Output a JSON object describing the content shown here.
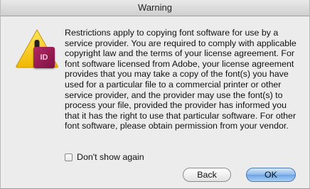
{
  "window": {
    "title": "Warning"
  },
  "icon": {
    "badge_text": "ID"
  },
  "dialog": {
    "message": "Restrictions apply to copying font software for use by a service provider.  You are required to comply with applicable copyright law and the terms of your license agreement.  For font software licensed from Adobe, your license agreement provides that you may take a copy of the font(s) you have used for a particular file to a commercial printer or other service provider, and the provider may use the font(s) to process your file, provided the provider has informed you that it has the right to use that particular software.  For other font software, please obtain permission from your vendor.",
    "checkbox_label": "Don't show again",
    "checkbox_checked": false
  },
  "buttons": {
    "back_label": "Back",
    "ok_label": "OK"
  },
  "colors": {
    "accent": "#6ea3e2",
    "warning": "#f6c400",
    "badge": "#a11d55"
  }
}
